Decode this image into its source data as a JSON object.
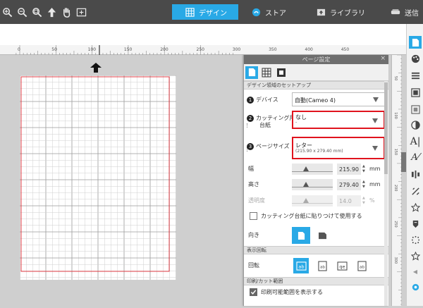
{
  "toolbar": {
    "icons": [
      "zoom-in-icon",
      "zoom-out-icon",
      "zoom-fit-icon",
      "move-icon",
      "pan-hand-icon",
      "fit-page-icon"
    ]
  },
  "tabs": [
    {
      "id": "design",
      "label": "デザイン",
      "active": true
    },
    {
      "id": "store",
      "label": "ストア",
      "active": false
    },
    {
      "id": "library",
      "label": "ライブラリ",
      "active": false
    },
    {
      "id": "send",
      "label": "送信",
      "active": false
    }
  ],
  "ruler": {
    "labels": [
      "0",
      "50",
      "100",
      "150",
      "200",
      "250",
      "300",
      "350",
      "400",
      "450"
    ],
    "vertical_labels": [
      "50",
      "100",
      "150",
      "200",
      "250",
      "300"
    ]
  },
  "panel": {
    "title": "ページ設定",
    "close": "×",
    "section_setup": "デザイン領域のセットアップ",
    "device": {
      "num": "1",
      "label": "デバイス",
      "value": "自動(Cameo 4)"
    },
    "mat": {
      "num": "2",
      "label_line1": "カッティング用",
      "label_line2": "台紙",
      "value": "なし",
      "sub": "-"
    },
    "page_size": {
      "num": "3",
      "label": "ページサイズ",
      "value": "レター",
      "sub": "(215.90 x 279.40 mm)"
    },
    "width": {
      "label": "幅",
      "value": "215.90",
      "unit": "mm"
    },
    "height": {
      "label": "高さ",
      "value": "279.40",
      "unit": "mm"
    },
    "transparency": {
      "label": "透明度",
      "value": "14.0",
      "unit": "%"
    },
    "use_mat_checkbox": {
      "label": "カッティング台紙に貼りつけて使用する",
      "checked": false
    },
    "orientation": {
      "label": "向き",
      "selected": "portrait"
    },
    "section_rotate": "表示回転",
    "rotate": {
      "label": "回転",
      "options": [
        "ab",
        "ab",
        "ab",
        "ab"
      ]
    },
    "section_print": "印刷/カット範囲",
    "show_print_area": {
      "label": "印刷可能範囲を表示する",
      "checked": true
    }
  },
  "colors": {
    "accent": "#29a9e6",
    "highlight_red": "#e0141e",
    "toolbar_bg": "#4a4a4a"
  }
}
